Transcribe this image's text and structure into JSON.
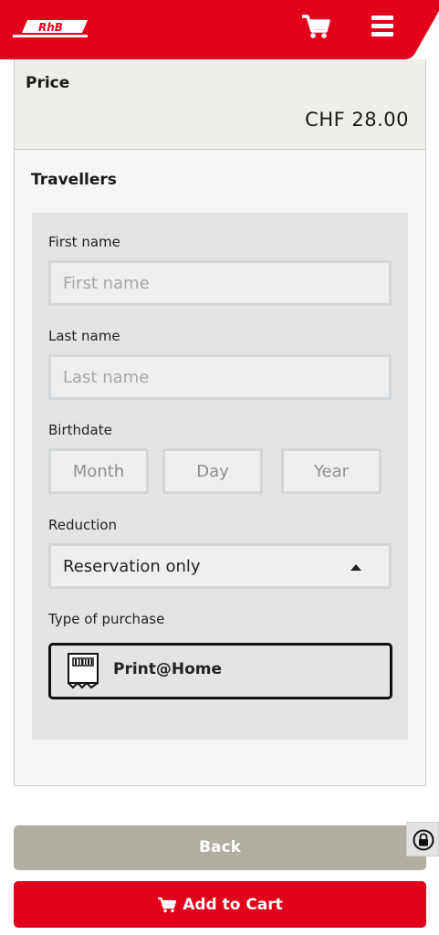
{
  "brand": {
    "logo_text": "RhB",
    "accent": "#e2001a"
  },
  "header": {
    "cart_icon": "shopping-cart-icon",
    "menu_icon": "hamburger-menu-icon"
  },
  "price": {
    "label": "Price",
    "value": "CHF 28.00"
  },
  "travellers": {
    "title": "Travellers",
    "first_name": {
      "label": "First name",
      "placeholder": "First name",
      "value": ""
    },
    "last_name": {
      "label": "Last name",
      "placeholder": "Last name",
      "value": ""
    },
    "birthdate": {
      "label": "Birthdate",
      "month_placeholder": "Month",
      "day_placeholder": "Day",
      "year_placeholder": "Year"
    },
    "reduction": {
      "label": "Reduction",
      "selected": "Reservation only"
    },
    "purchase_type": {
      "label": "Type of purchase",
      "option": "Print@Home",
      "icon": "printed-ticket-icon"
    }
  },
  "actions": {
    "back": "Back",
    "add_to_cart": "Add to Cart"
  },
  "lock_icon": "lock-icon"
}
